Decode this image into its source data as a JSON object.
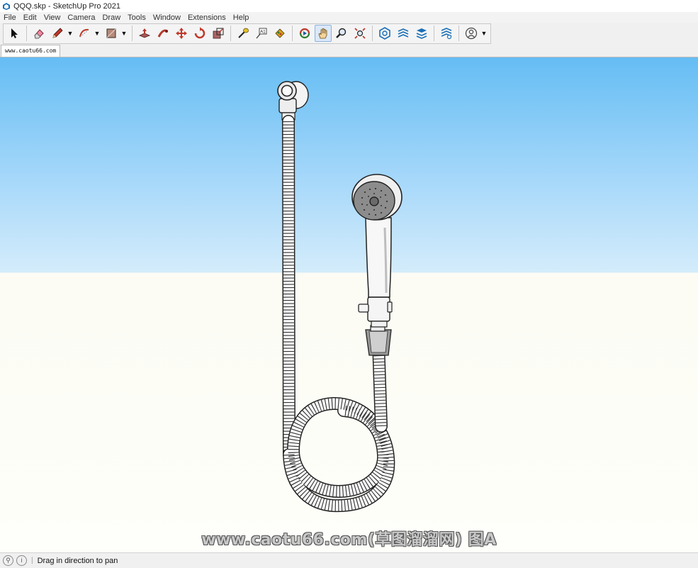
{
  "window": {
    "title": "QQQ.skp - SketchUp Pro 2021"
  },
  "menu": [
    "File",
    "Edit",
    "View",
    "Camera",
    "Draw",
    "Tools",
    "Window",
    "Extensions",
    "Help"
  ],
  "toolbar": {
    "tools": [
      "select-icon",
      "eraser-icon",
      "line-pencil-icon",
      "arc-icon",
      "rectangle-icon",
      "push-pull-icon",
      "follow-me-icon",
      "move-icon",
      "rotate-icon",
      "scale-icon",
      "tape-measure-icon",
      "text-label-icon",
      "paint-bucket-icon",
      "orbit-icon",
      "pan-icon",
      "zoom-icon",
      "zoom-extents-icon",
      "3d-warehouse-icon",
      "extension-warehouse-icon",
      "layout-icon",
      "extension-manager-icon",
      "profile-icon"
    ],
    "active_tool": "pan-icon"
  },
  "scene_tab": {
    "label": "www.caotu66.com"
  },
  "viewport": {
    "sky_color": "#65bdf4",
    "ground_color": "#fefefa",
    "watermark": "www.caotu66.com(草图溜溜网) 图A"
  },
  "status": {
    "message": "Drag in direction to pan"
  }
}
